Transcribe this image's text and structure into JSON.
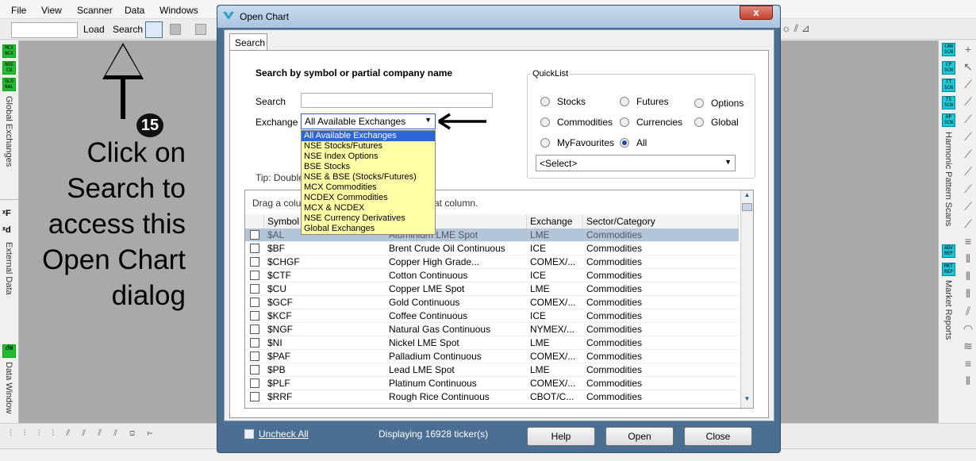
{
  "menubar": {
    "file": "File",
    "view": "View",
    "scanner": "Scanner",
    "data": "Data",
    "windows": "Windows"
  },
  "toolbar": {
    "load": "Load",
    "search": "Search"
  },
  "left_panel": {
    "buttons": [
      {
        "t": "MCX\nNCX"
      },
      {
        "t": "NSE\nCD"
      },
      {
        "t": "GLO\nBAL"
      }
    ],
    "global_exchanges": "Global Exchanges",
    "external_data": "External Data",
    "data_window": "Data Window"
  },
  "right_panel": {
    "buttons": [
      {
        "t": "CAN\nSCN"
      },
      {
        "t": "CP\nSCN"
      },
      {
        "t": "TT\nSCN"
      },
      {
        "t": "TS\nSCN"
      },
      {
        "t": "HP\nSCN"
      },
      {
        "t": "ADV\nREP"
      },
      {
        "t": "MKT\nREP"
      }
    ],
    "harmonic": "Harmonic Pattern Scans",
    "market_reports": "Market Reports"
  },
  "annotation": {
    "step": "15",
    "text": "Click on Search to access this Open Chart dialog"
  },
  "dialog": {
    "title": "Open Chart",
    "close": "x",
    "tab": "Search",
    "heading": "Search by symbol or partial company name",
    "search_label": "Search",
    "search_value": "",
    "exchange_label": "Exchange",
    "exchange_selected": "All Available Exchanges",
    "exchange_options": [
      "All Available Exchanges",
      "NSE Stocks/Futures",
      "NSE Index Options",
      "BSE Stocks",
      "NSE & BSE (Stocks/Futures)",
      "MCX Commodities",
      "NCDEX  Commodities",
      "MCX & NCDEX",
      "NSE Currency Derivatives",
      "Global Exchanges"
    ],
    "tip": "Tip: Double-",
    "quicklist": {
      "title": "QuickList",
      "stocks": "Stocks",
      "futures": "Futures",
      "options": "Options",
      "commodities": "Commodities",
      "currencies": "Currencies",
      "global": "Global",
      "myfavourites": "MyFavourites",
      "all": "All",
      "select": "<Select>"
    },
    "grid_hint_left": "Drag a colu",
    "grid_hint_right": "at column.",
    "columns": {
      "symbol": "Symbol",
      "exchange": "Exchange",
      "sector": "Sector/Category"
    },
    "rows": [
      {
        "symbol": "$AL",
        "name": "Aluminium LME Spot",
        "exchange": "LME",
        "sector": "Commodities"
      },
      {
        "symbol": "$BF",
        "name": "Brent Crude Oil Continuous",
        "exchange": "ICE",
        "sector": "Commodities"
      },
      {
        "symbol": "$CHGF",
        "name": "Copper High Grade...",
        "exchange": "COMEX/...",
        "sector": "Commodities"
      },
      {
        "symbol": "$CTF",
        "name": "Cotton Continuous",
        "exchange": "ICE",
        "sector": "Commodities"
      },
      {
        "symbol": "$CU",
        "name": "Copper LME Spot",
        "exchange": "LME",
        "sector": "Commodities"
      },
      {
        "symbol": "$GCF",
        "name": "Gold Continuous",
        "exchange": "COMEX/...",
        "sector": "Commodities"
      },
      {
        "symbol": "$KCF",
        "name": "Coffee Continuous",
        "exchange": "ICE",
        "sector": "Commodities"
      },
      {
        "symbol": "$NGF",
        "name": "Natural Gas Continuous",
        "exchange": "NYMEX/...",
        "sector": "Commodities"
      },
      {
        "symbol": "$NI",
        "name": "Nickel LME Spot",
        "exchange": "LME",
        "sector": "Commodities"
      },
      {
        "symbol": "$PAF",
        "name": "Palladium Continuous",
        "exchange": "COMEX/...",
        "sector": "Commodities"
      },
      {
        "symbol": "$PB",
        "name": "Lead LME Spot",
        "exchange": "LME",
        "sector": "Commodities"
      },
      {
        "symbol": "$PLF",
        "name": "Platinum Continuous",
        "exchange": "COMEX/...",
        "sector": "Commodities"
      },
      {
        "symbol": "$RRF",
        "name": "Rough Rice Continuous",
        "exchange": "CBOT/C...",
        "sector": "Commodities"
      }
    ],
    "uncheck_all": "Uncheck All",
    "displaying": "Displaying 16928 ticker(s)",
    "help": "Help",
    "open": "Open",
    "close_btn": "Close"
  }
}
